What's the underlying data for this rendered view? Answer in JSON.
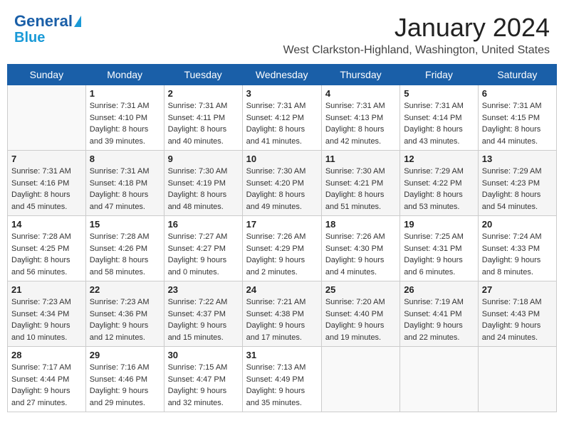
{
  "header": {
    "logo_line1": "General",
    "logo_line2": "Blue",
    "title": "January 2024",
    "subtitle": "West Clarkston-Highland, Washington, United States"
  },
  "weekdays": [
    "Sunday",
    "Monday",
    "Tuesday",
    "Wednesday",
    "Thursday",
    "Friday",
    "Saturday"
  ],
  "weeks": [
    [
      {
        "day": "",
        "sunrise": "",
        "sunset": "",
        "daylight": ""
      },
      {
        "day": "1",
        "sunrise": "Sunrise: 7:31 AM",
        "sunset": "Sunset: 4:10 PM",
        "daylight": "Daylight: 8 hours and 39 minutes."
      },
      {
        "day": "2",
        "sunrise": "Sunrise: 7:31 AM",
        "sunset": "Sunset: 4:11 PM",
        "daylight": "Daylight: 8 hours and 40 minutes."
      },
      {
        "day": "3",
        "sunrise": "Sunrise: 7:31 AM",
        "sunset": "Sunset: 4:12 PM",
        "daylight": "Daylight: 8 hours and 41 minutes."
      },
      {
        "day": "4",
        "sunrise": "Sunrise: 7:31 AM",
        "sunset": "Sunset: 4:13 PM",
        "daylight": "Daylight: 8 hours and 42 minutes."
      },
      {
        "day": "5",
        "sunrise": "Sunrise: 7:31 AM",
        "sunset": "Sunset: 4:14 PM",
        "daylight": "Daylight: 8 hours and 43 minutes."
      },
      {
        "day": "6",
        "sunrise": "Sunrise: 7:31 AM",
        "sunset": "Sunset: 4:15 PM",
        "daylight": "Daylight: 8 hours and 44 minutes."
      }
    ],
    [
      {
        "day": "7",
        "sunrise": "Sunrise: 7:31 AM",
        "sunset": "Sunset: 4:16 PM",
        "daylight": "Daylight: 8 hours and 45 minutes."
      },
      {
        "day": "8",
        "sunrise": "Sunrise: 7:31 AM",
        "sunset": "Sunset: 4:18 PM",
        "daylight": "Daylight: 8 hours and 47 minutes."
      },
      {
        "day": "9",
        "sunrise": "Sunrise: 7:30 AM",
        "sunset": "Sunset: 4:19 PM",
        "daylight": "Daylight: 8 hours and 48 minutes."
      },
      {
        "day": "10",
        "sunrise": "Sunrise: 7:30 AM",
        "sunset": "Sunset: 4:20 PM",
        "daylight": "Daylight: 8 hours and 49 minutes."
      },
      {
        "day": "11",
        "sunrise": "Sunrise: 7:30 AM",
        "sunset": "Sunset: 4:21 PM",
        "daylight": "Daylight: 8 hours and 51 minutes."
      },
      {
        "day": "12",
        "sunrise": "Sunrise: 7:29 AM",
        "sunset": "Sunset: 4:22 PM",
        "daylight": "Daylight: 8 hours and 53 minutes."
      },
      {
        "day": "13",
        "sunrise": "Sunrise: 7:29 AM",
        "sunset": "Sunset: 4:23 PM",
        "daylight": "Daylight: 8 hours and 54 minutes."
      }
    ],
    [
      {
        "day": "14",
        "sunrise": "Sunrise: 7:28 AM",
        "sunset": "Sunset: 4:25 PM",
        "daylight": "Daylight: 8 hours and 56 minutes."
      },
      {
        "day": "15",
        "sunrise": "Sunrise: 7:28 AM",
        "sunset": "Sunset: 4:26 PM",
        "daylight": "Daylight: 8 hours and 58 minutes."
      },
      {
        "day": "16",
        "sunrise": "Sunrise: 7:27 AM",
        "sunset": "Sunset: 4:27 PM",
        "daylight": "Daylight: 9 hours and 0 minutes."
      },
      {
        "day": "17",
        "sunrise": "Sunrise: 7:26 AM",
        "sunset": "Sunset: 4:29 PM",
        "daylight": "Daylight: 9 hours and 2 minutes."
      },
      {
        "day": "18",
        "sunrise": "Sunrise: 7:26 AM",
        "sunset": "Sunset: 4:30 PM",
        "daylight": "Daylight: 9 hours and 4 minutes."
      },
      {
        "day": "19",
        "sunrise": "Sunrise: 7:25 AM",
        "sunset": "Sunset: 4:31 PM",
        "daylight": "Daylight: 9 hours and 6 minutes."
      },
      {
        "day": "20",
        "sunrise": "Sunrise: 7:24 AM",
        "sunset": "Sunset: 4:33 PM",
        "daylight": "Daylight: 9 hours and 8 minutes."
      }
    ],
    [
      {
        "day": "21",
        "sunrise": "Sunrise: 7:23 AM",
        "sunset": "Sunset: 4:34 PM",
        "daylight": "Daylight: 9 hours and 10 minutes."
      },
      {
        "day": "22",
        "sunrise": "Sunrise: 7:23 AM",
        "sunset": "Sunset: 4:36 PM",
        "daylight": "Daylight: 9 hours and 12 minutes."
      },
      {
        "day": "23",
        "sunrise": "Sunrise: 7:22 AM",
        "sunset": "Sunset: 4:37 PM",
        "daylight": "Daylight: 9 hours and 15 minutes."
      },
      {
        "day": "24",
        "sunrise": "Sunrise: 7:21 AM",
        "sunset": "Sunset: 4:38 PM",
        "daylight": "Daylight: 9 hours and 17 minutes."
      },
      {
        "day": "25",
        "sunrise": "Sunrise: 7:20 AM",
        "sunset": "Sunset: 4:40 PM",
        "daylight": "Daylight: 9 hours and 19 minutes."
      },
      {
        "day": "26",
        "sunrise": "Sunrise: 7:19 AM",
        "sunset": "Sunset: 4:41 PM",
        "daylight": "Daylight: 9 hours and 22 minutes."
      },
      {
        "day": "27",
        "sunrise": "Sunrise: 7:18 AM",
        "sunset": "Sunset: 4:43 PM",
        "daylight": "Daylight: 9 hours and 24 minutes."
      }
    ],
    [
      {
        "day": "28",
        "sunrise": "Sunrise: 7:17 AM",
        "sunset": "Sunset: 4:44 PM",
        "daylight": "Daylight: 9 hours and 27 minutes."
      },
      {
        "day": "29",
        "sunrise": "Sunrise: 7:16 AM",
        "sunset": "Sunset: 4:46 PM",
        "daylight": "Daylight: 9 hours and 29 minutes."
      },
      {
        "day": "30",
        "sunrise": "Sunrise: 7:15 AM",
        "sunset": "Sunset: 4:47 PM",
        "daylight": "Daylight: 9 hours and 32 minutes."
      },
      {
        "day": "31",
        "sunrise": "Sunrise: 7:13 AM",
        "sunset": "Sunset: 4:49 PM",
        "daylight": "Daylight: 9 hours and 35 minutes."
      },
      {
        "day": "",
        "sunrise": "",
        "sunset": "",
        "daylight": ""
      },
      {
        "day": "",
        "sunrise": "",
        "sunset": "",
        "daylight": ""
      },
      {
        "day": "",
        "sunrise": "",
        "sunset": "",
        "daylight": ""
      }
    ]
  ]
}
